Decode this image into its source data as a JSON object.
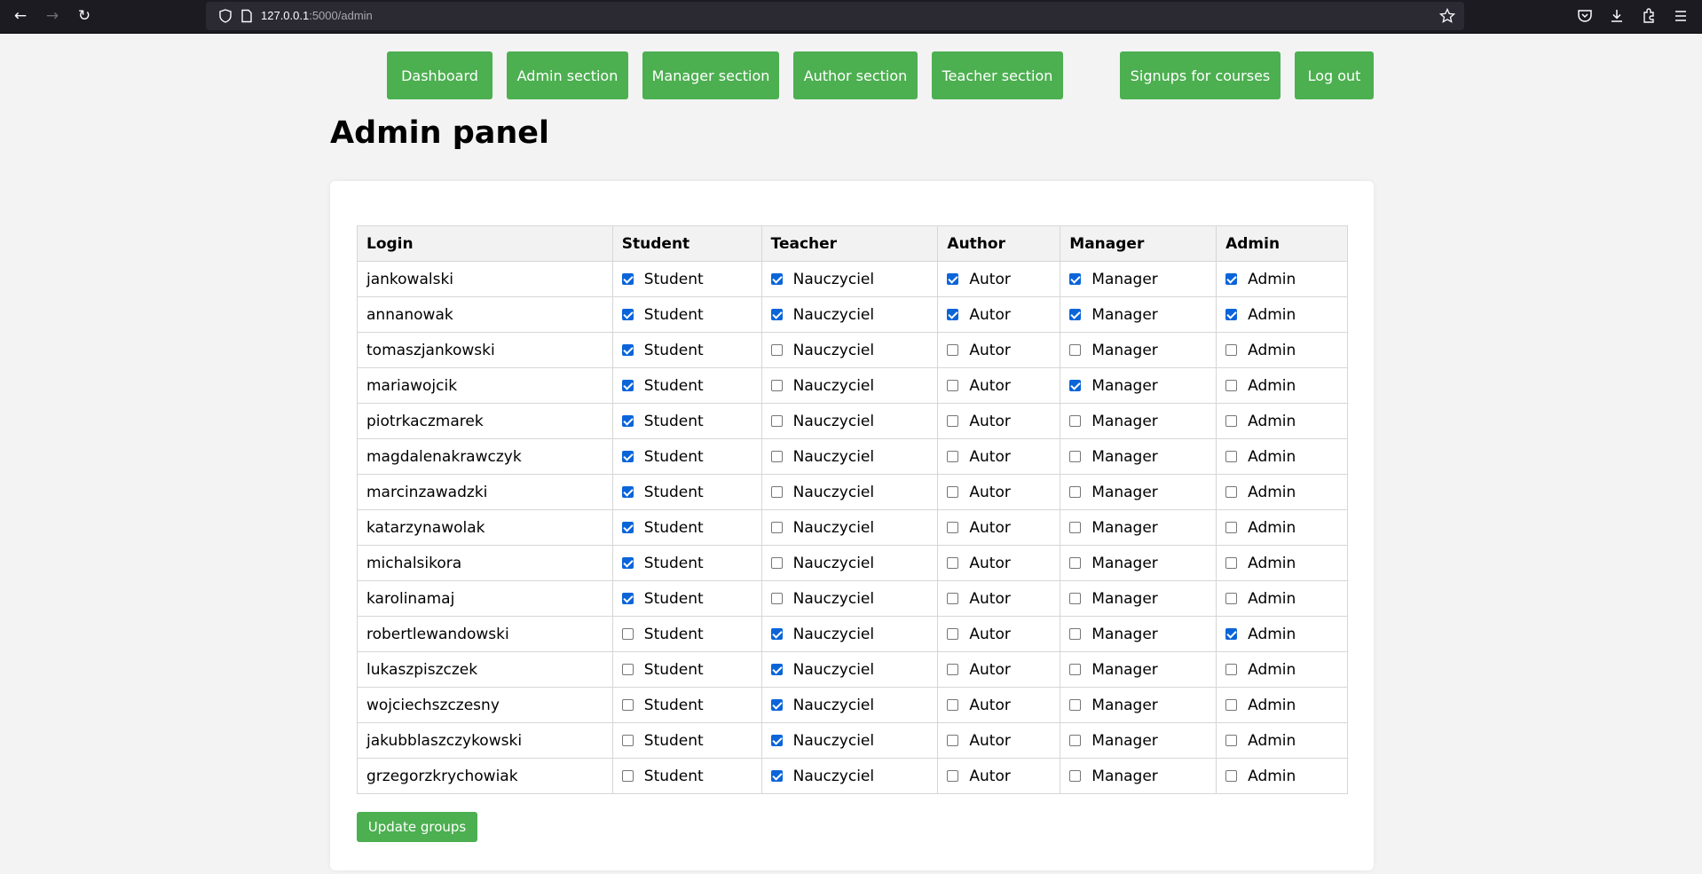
{
  "browser": {
    "url_host": "127.0.0.1",
    "url_path": ":5000/admin"
  },
  "nav": {
    "dashboard": "Dashboard",
    "admin": "Admin section",
    "manager": "Manager section",
    "author": "Author section",
    "teacher": "Teacher section",
    "signups": "Signups for courses",
    "logout": "Log out"
  },
  "page": {
    "title": "Admin panel"
  },
  "table": {
    "headers": [
      "Login",
      "Student",
      "Teacher",
      "Author",
      "Manager",
      "Admin"
    ],
    "option_labels": [
      "Student",
      "Nauczyciel",
      "Autor",
      "Manager",
      "Admin"
    ],
    "rows": [
      {
        "login": "jankowalski",
        "checks": [
          true,
          true,
          true,
          true,
          true
        ]
      },
      {
        "login": "annanowak",
        "checks": [
          true,
          true,
          true,
          true,
          true
        ]
      },
      {
        "login": "tomaszjankowski",
        "checks": [
          true,
          false,
          false,
          false,
          false
        ]
      },
      {
        "login": "mariawojcik",
        "checks": [
          true,
          false,
          false,
          true,
          false
        ]
      },
      {
        "login": "piotrkaczmarek",
        "checks": [
          true,
          false,
          false,
          false,
          false
        ]
      },
      {
        "login": "magdalenakrawczyk",
        "checks": [
          true,
          false,
          false,
          false,
          false
        ]
      },
      {
        "login": "marcinzawadzki",
        "checks": [
          true,
          false,
          false,
          false,
          false
        ]
      },
      {
        "login": "katarzynawolak",
        "checks": [
          true,
          false,
          false,
          false,
          false
        ]
      },
      {
        "login": "michalsikora",
        "checks": [
          true,
          false,
          false,
          false,
          false
        ]
      },
      {
        "login": "karolinamaj",
        "checks": [
          true,
          false,
          false,
          false,
          false
        ]
      },
      {
        "login": "robertlewandowski",
        "checks": [
          false,
          true,
          false,
          false,
          true
        ]
      },
      {
        "login": "lukaszpiszczek",
        "checks": [
          false,
          true,
          false,
          false,
          false
        ]
      },
      {
        "login": "wojciechszczesny",
        "checks": [
          false,
          true,
          false,
          false,
          false
        ]
      },
      {
        "login": "jakubblaszczykowski",
        "checks": [
          false,
          true,
          false,
          false,
          false
        ]
      },
      {
        "login": "grzegorzkrychowiak",
        "checks": [
          false,
          true,
          false,
          false,
          false
        ]
      }
    ]
  },
  "update_button": "Update groups",
  "colors": {
    "accent_green": "#4caf50",
    "checkbox_blue": "#0b65d9",
    "page_bg": "#f3f3f3"
  }
}
